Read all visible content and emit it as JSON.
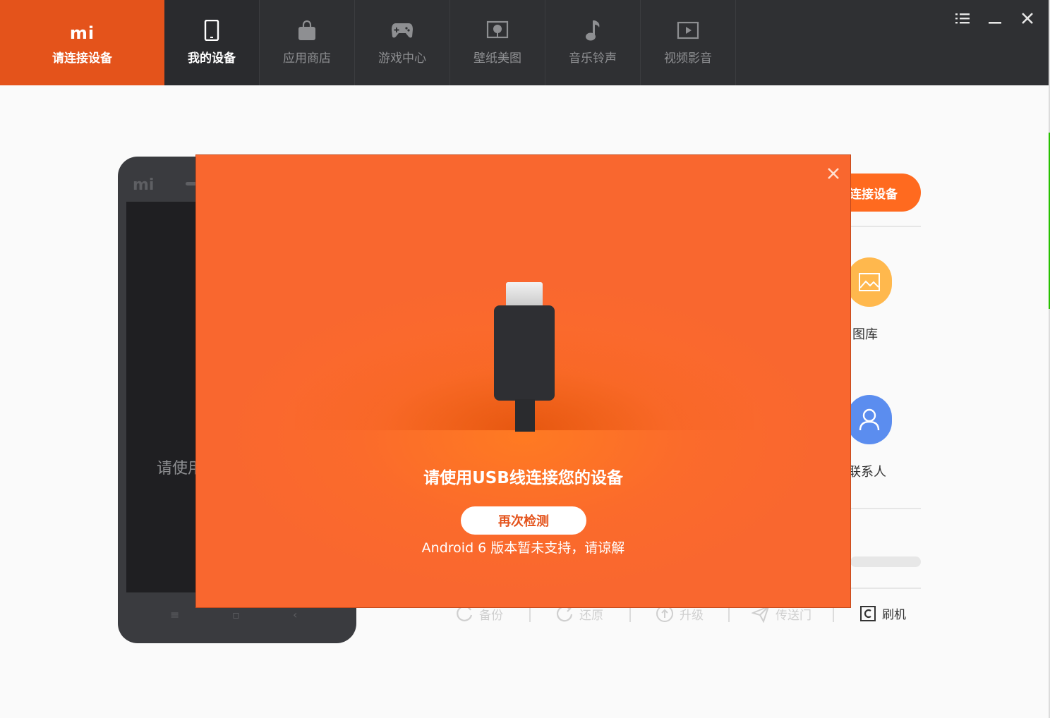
{
  "brand": {
    "logo": "mi",
    "label": "请连接设备"
  },
  "tabs": [
    {
      "label": "我的设备",
      "icon": "phone-icon",
      "active": true
    },
    {
      "label": "应用商店",
      "icon": "shopping-bag-icon"
    },
    {
      "label": "游戏中心",
      "icon": "gamepad-icon"
    },
    {
      "label": "壁纸美图",
      "icon": "picture-icon"
    },
    {
      "label": "音乐铃声",
      "icon": "music-note-icon"
    },
    {
      "label": "视频影音",
      "icon": "play-video-icon"
    }
  ],
  "window_controls": [
    "menu-icon",
    "minimize-icon",
    "close-icon"
  ],
  "phone": {
    "logo": "mi",
    "screen_text": "请使用"
  },
  "right_panel": {
    "connect_button": "连接设备",
    "features": [
      {
        "label": "图库",
        "icon": "gallery-icon",
        "color": "#ffb84d"
      },
      {
        "label": "联系人",
        "icon": "contacts-icon",
        "color": "#5b8def"
      }
    ],
    "tools": [
      "备份",
      "还原",
      "升级",
      "传送门",
      "刷机"
    ]
  },
  "dialog": {
    "headline": "请使用USB线连接您的设备",
    "retry_button": "再次检测",
    "note": "Android 6 版本暂未支持，请谅解"
  },
  "colors": {
    "accent": "#e4531b",
    "dialog_bg": "#fb6b2b",
    "topbar": "#2f3033"
  }
}
